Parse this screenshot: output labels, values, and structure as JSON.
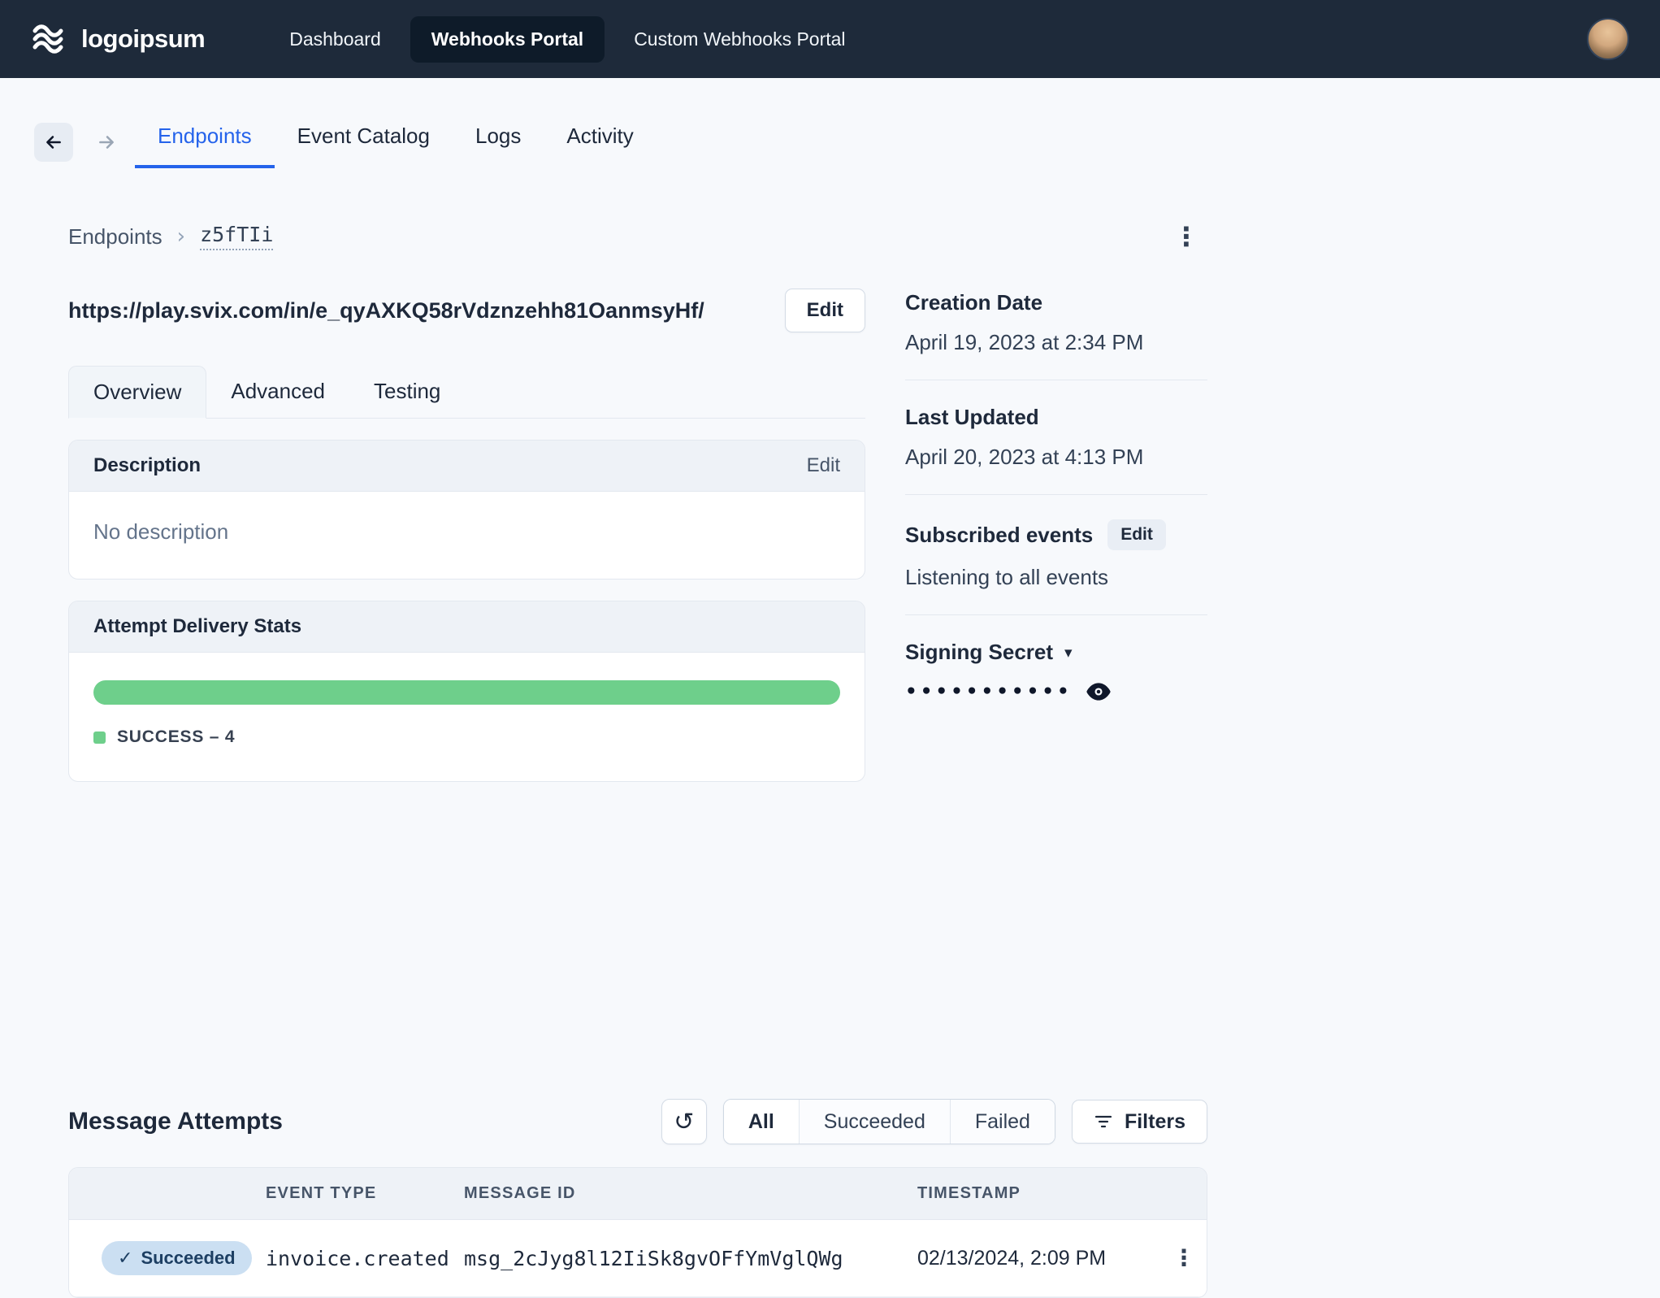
{
  "colors": {
    "navbar_bg": "#1e2a3a",
    "navbar_active": "#0e1b29",
    "accent": "#2563eb",
    "success": "#6ecf8b",
    "badge_bg": "#cbdff2",
    "badge_text": "#1d3f63"
  },
  "navbar": {
    "logo_text": "logoipsum",
    "items": [
      {
        "label": "Dashboard"
      },
      {
        "label": "Webhooks Portal",
        "active": true
      },
      {
        "label": "Custom Webhooks Portal"
      }
    ]
  },
  "portal_tabs": {
    "items": [
      "Endpoints",
      "Event Catalog",
      "Logs",
      "Activity"
    ],
    "active": "Endpoints"
  },
  "breadcrumb": {
    "root": "Endpoints",
    "current": "z5fTIi"
  },
  "endpoint": {
    "url": "https://play.svix.com/in/e_qyAXKQ58rVdznzehh81OanmsyHf/",
    "edit_label": "Edit"
  },
  "detail_tabs": {
    "items": [
      "Overview",
      "Advanced",
      "Testing"
    ],
    "active": "Overview"
  },
  "description_card": {
    "title": "Description",
    "edit_label": "Edit",
    "body": "No description"
  },
  "stats_card": {
    "title": "Attempt Delivery Stats",
    "legend": "SUCCESS – 4",
    "bar_pct": 100
  },
  "sidebar": {
    "creation_date": {
      "label": "Creation Date",
      "value": "April 19, 2023 at 2:34 PM"
    },
    "last_updated": {
      "label": "Last Updated",
      "value": "April 20, 2023 at 4:13 PM"
    },
    "subscribed_events": {
      "label": "Subscribed events",
      "edit_label": "Edit",
      "value": "Listening to all events"
    },
    "signing_secret": {
      "label": "Signing Secret",
      "masked_value": "•••••••••••"
    }
  },
  "message_attempts": {
    "title": "Message Attempts",
    "filter_tabs": [
      "All",
      "Succeeded",
      "Failed"
    ],
    "active_filter": "All",
    "filters_button_label": "Filters",
    "table": {
      "headers": [
        "",
        "EVENT TYPE",
        "MESSAGE ID",
        "TIMESTAMP",
        ""
      ],
      "rows": [
        {
          "status": "Succeeded",
          "event_type": "invoice.created",
          "message_id": "msg_2cJyg8l12IiSk8gvOFfYmVglQWg",
          "timestamp": "02/13/2024, 2:09 PM"
        }
      ]
    }
  },
  "glyphs": {
    "kebab": "⋮",
    "crumb_sep": "›",
    "refresh": "↺",
    "check": "✓",
    "chevron_down": "▾"
  }
}
